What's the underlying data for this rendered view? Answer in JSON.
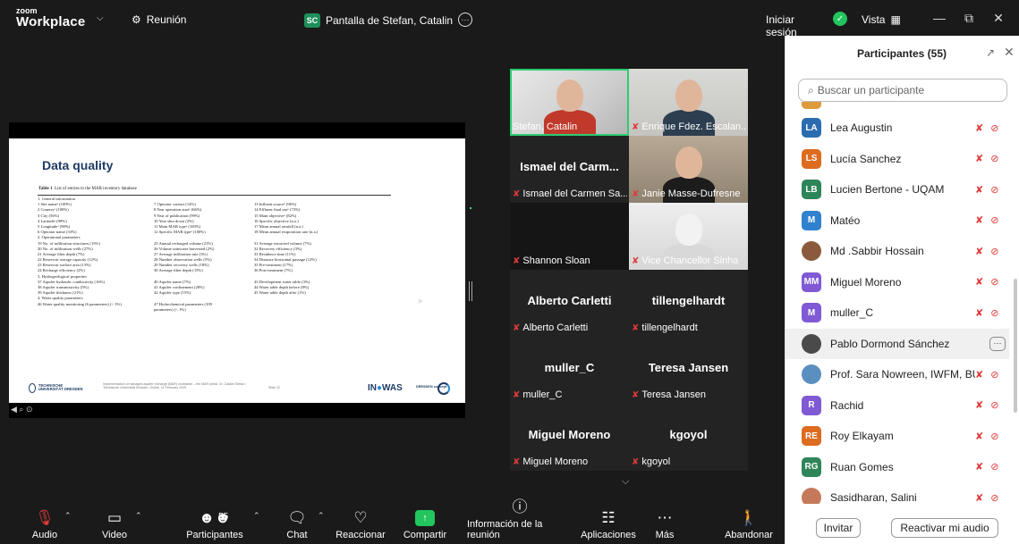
{
  "app": {
    "logo_line1": "zoom",
    "logo_line2": "Workplace",
    "meeting_label": "Reunión",
    "share_badge": "SC",
    "share_title": "Pantalla de Stefan, Catalin",
    "sign_in": "Iniciar sesión",
    "view_label": "Vista",
    "colors": {
      "accent_green": "#22c55e",
      "muted_red": "#e03b3b",
      "active_border": "#2ecc71"
    }
  },
  "slide": {
    "title": "Data quality",
    "caption_bold": "Table 1",
    "caption": "List of entries in the MAR inventory database",
    "rows": [
      [
        "1. General information",
        "",
        ""
      ],
      [
        "1     Site nameᵃ (100%)",
        "7     Operator contact (14%)",
        "13    Influent sourceᵃ (96%)"
      ],
      [
        "2     Countryᵃ (100%)",
        "8     Year operation startᵃ (66%)",
        "14    Effluent final useᵃ (73%)"
      ],
      [
        "3     City (56%)",
        "9     Year of publication (99%)",
        "15    Main objectiveᵃ (82%)"
      ],
      [
        "4     Latitudeᵃ (98%)",
        "10    Year shut down (2%)",
        "16    Specific objective (n.a.)"
      ],
      [
        "5     Longitudeᵃ (98%)",
        "11    Main MAR typeᵃ (100%)",
        "17    Mean annual rainfall (n.a.)"
      ],
      [
        "6     Operator name (33%)",
        "12    Specific MAR typeᵃ (100%)",
        "18    Mean annual evaporation rate (n.a.)"
      ],
      [
        "2. Operational parameters",
        "",
        ""
      ],
      [
        "19    No. of infiltration structures (15%)",
        "25    Annual recharged volume (21%)",
        "31    Average extracted volume (7%)"
      ],
      [
        "20    No. of infiltration wells (27%)",
        "26    Volume rainwater harvested (2%)",
        "32    Recovery efficiency (3%)"
      ],
      [
        "21    Average filter depth (7%)",
        "27    Average infiltration rate (3%)",
        "33    Residence time (11%)"
      ],
      [
        "22    Reservoir storage capacity (12%)",
        "28    Number observation wells (5%)",
        "34    Distance horizontal passage (12%)"
      ],
      [
        "23    Reservoir surface area (13%)",
        "29    Number recovery wells (18%)",
        "35    Pre-treatment (17%)"
      ],
      [
        "24    Recharge efficiency (2%)",
        "30    Average filter depth (15%)",
        "36    Post-treatment (7%)"
      ],
      [
        "3. Hydrogeological properties",
        "",
        ""
      ],
      [
        "37    Aquifer hydraulic conductivity (16%)",
        "40    Aquifer name (7%)",
        "43    Development water table (3%)"
      ],
      [
        "38    Aquifer transmissivity (5%)",
        "41    Aquifer confinement (28%)",
        "44    Water table depth before (8%)"
      ],
      [
        "39    Aquifer thickness (21%)",
        "42    Aquifer type (15%)",
        "45    Water table depth after (1%)"
      ],
      [
        "4. Water quality parameters",
        "",
        ""
      ],
      [
        "46    Water quality monitoring (6 parameters) (< 1%)",
        "47    Hydrochemical parameters (109",
        ""
      ],
      [
        "",
        "        parameters) (< 1%)",
        ""
      ]
    ],
    "uni_name": "TECHNISCHE UNIVERSITÄT DRESDEN",
    "footer_note": "Implementation of managed aquifer recharge (MAR) worldwide – the MAR portal. Dr. Catalin Stefan / Technische Universität Dresden. Online, 11 February 2025",
    "slide_num": "Slide 12",
    "inowas_a": "IN",
    "inowas_b": "WAS",
    "dresden": "DRESDEN concept"
  },
  "gallery": [
    {
      "name": "Stefan, Catalin",
      "muted": false,
      "video": true,
      "active": true
    },
    {
      "name": "Enrique Fdez. Escalan...",
      "muted": true,
      "video": true
    },
    {
      "name": "Ismael del Carmen Sa...",
      "big": "Ismael del Carm...",
      "muted": true,
      "video": false
    },
    {
      "name": "Janie Masse-Dufresne",
      "muted": true,
      "video": true
    },
    {
      "name": "Shannon Sloan",
      "muted": true,
      "video": false,
      "dark": true
    },
    {
      "name": "Vice Chancellor Sinha",
      "muted": true,
      "video": true
    },
    {
      "name": "Alberto Carletti",
      "big": "Alberto Carletti",
      "muted": true
    },
    {
      "name": "tillengelhardt",
      "big": "tillengelhardt",
      "muted": true
    },
    {
      "name": "muller_C",
      "big": "muller_C",
      "muted": true
    },
    {
      "name": "Teresa Jansen",
      "big": "Teresa Jansen",
      "muted": true
    },
    {
      "name": "Miguel Moreno",
      "big": "Miguel Moreno",
      "muted": true
    },
    {
      "name": "kgoyol",
      "big": "kgoyol",
      "muted": true
    }
  ],
  "toolbar": {
    "audio": "Audio",
    "video": "Video",
    "participants": "Participantes",
    "participants_count": "55",
    "chat": "Chat",
    "react": "Reaccionar",
    "share": "Compartir",
    "info": "Información de la reunión",
    "apps": "Aplicaciones",
    "more": "Más",
    "leave": "Abandonar"
  },
  "panel": {
    "title": "Participantes (55)",
    "search_placeholder": "Buscar un participante",
    "participants": [
      {
        "initials": "LA",
        "name": "Lea Augustin",
        "color": "#2b6cb0"
      },
      {
        "initials": "LS",
        "name": "Lucía Sanchez",
        "color": "#dd6b20"
      },
      {
        "initials": "LB",
        "name": "Lucien Bertone - UQAM",
        "color": "#2f855a"
      },
      {
        "initials": "M",
        "name": "Matéo",
        "color": "#3182ce"
      },
      {
        "initials": "",
        "name": "Md .Sabbir Hossain",
        "color": "#8b5a3c",
        "img": true
      },
      {
        "initials": "MM",
        "name": "Miguel Moreno",
        "color": "#805ad5"
      },
      {
        "initials": "M",
        "name": "muller_C",
        "color": "#805ad5"
      },
      {
        "initials": "",
        "name": "Pablo Dormond Sánchez",
        "color": "#4a4a4a",
        "img": true,
        "highlight": true
      },
      {
        "initials": "",
        "name": "Prof. Sara Nowreen, IWFM, BUET",
        "color": "#5a8fc0",
        "img": true
      },
      {
        "initials": "R",
        "name": "Rachid",
        "color": "#805ad5"
      },
      {
        "initials": "RE",
        "name": "Roy Elkayam",
        "color": "#dd6b20"
      },
      {
        "initials": "RG",
        "name": "Ruan Gomes",
        "color": "#2f855a"
      },
      {
        "initials": "",
        "name": "Sasidharan, Salini",
        "color": "#c47a5a",
        "img": true
      }
    ],
    "invite": "Invitar",
    "unmute_me": "Reactivar mi audio"
  }
}
